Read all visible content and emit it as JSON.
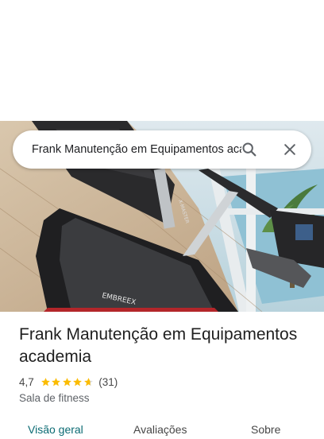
{
  "search": {
    "query": "Frank Manutenção em Equipamentos academia",
    "search_icon": "search-icon",
    "close_icon": "close-icon"
  },
  "photo": {
    "brand_text": "EMBREEX",
    "side_text": "X-MASTER"
  },
  "place": {
    "name": "Frank Manutenção em Equipamentos academia",
    "rating": "4,7",
    "rating_value": 4.7,
    "review_count": "(31)",
    "category": "Sala de fitness"
  },
  "tabs": [
    {
      "label": "Visão geral",
      "active": true
    },
    {
      "label": "Avaliações",
      "active": false
    },
    {
      "label": "Sobre",
      "active": false
    }
  ],
  "colors": {
    "star": "#fbbc04",
    "active_tab": "#0b6b73"
  }
}
